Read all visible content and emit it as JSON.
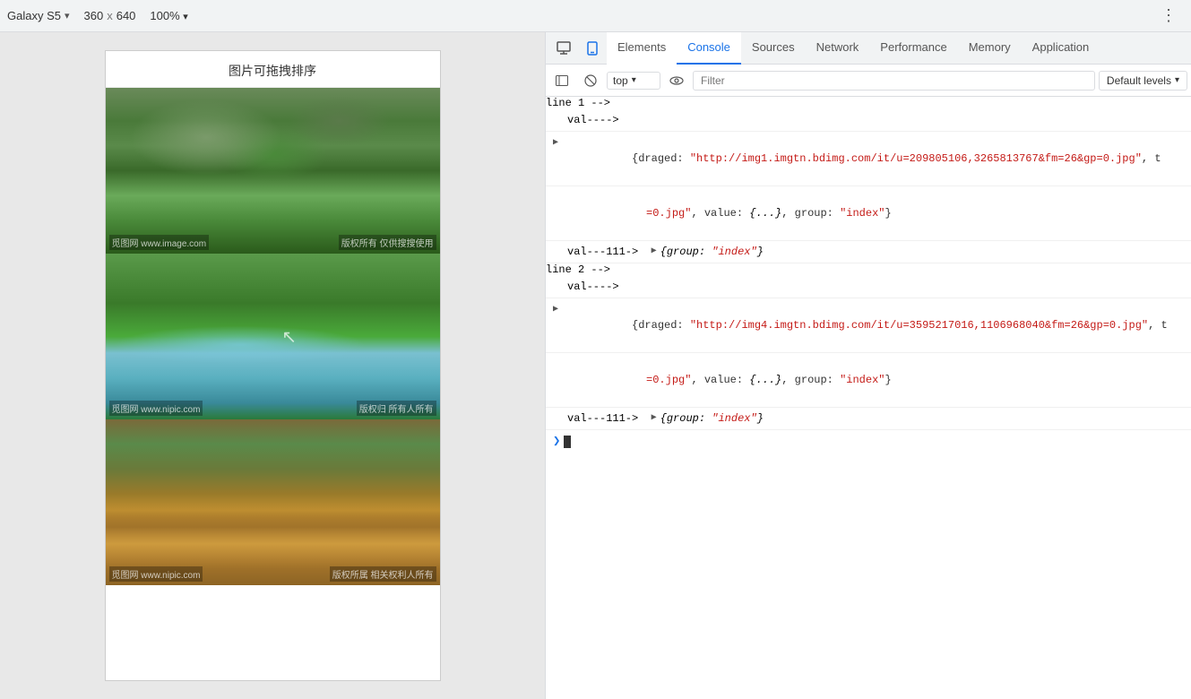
{
  "toolbar": {
    "device_name": "Galaxy S5",
    "chevron": "▾",
    "width": "360",
    "separator": "x",
    "height": "640",
    "zoom": "100%",
    "zoom_chevron": "▾",
    "more_icon": "⋮"
  },
  "viewport": {
    "page_title": "图片可拖拽排序",
    "images": [
      {
        "id": "img1",
        "watermark_left": "觅图网 www.image.com",
        "watermark_right": "版权所有 仅供搜搜使用"
      },
      {
        "id": "img2",
        "watermark_left": "觅图网 www.nipic.com",
        "watermark_right": "版权归 所有人所有"
      },
      {
        "id": "img3",
        "watermark_left": "觅图网 www.nipic.com",
        "watermark_right": "版权所属 相关权利人所有"
      }
    ]
  },
  "devtools": {
    "tabs": [
      {
        "id": "elements",
        "label": "Elements",
        "active": false
      },
      {
        "id": "console",
        "label": "Console",
        "active": true
      },
      {
        "id": "sources",
        "label": "Sources",
        "active": false
      },
      {
        "id": "network",
        "label": "Network",
        "active": false
      },
      {
        "id": "performance",
        "label": "Performance",
        "active": false
      },
      {
        "id": "memory",
        "label": "Memory",
        "active": false
      },
      {
        "id": "application",
        "label": "Application",
        "active": false
      }
    ],
    "console": {
      "context": "top",
      "context_chevron": "▾",
      "filter_placeholder": "Filter",
      "levels_label": "Default levels",
      "levels_chevron": "▾",
      "output": [
        {
          "type": "text",
          "content": "val---->",
          "indent": false,
          "expandable": false
        },
        {
          "type": "object",
          "expandable": true,
          "content": "{draged: \"http://img1.imgtn.bdimg.com/it/u=209805106,3265813767&fm=26&gp=0.jpg\", t=0.jpg\", value: {...}, group: \"index\"}"
        },
        {
          "type": "text",
          "content": "val---111-> ▶ {group: \"index\"}",
          "expandable": false
        },
        {
          "type": "text",
          "content": "val---->",
          "expandable": false
        },
        {
          "type": "object",
          "expandable": true,
          "content": "{draged: \"http://img4.imgtn.bdimg.com/it/u=3595217016,1106968040&fm=26&gp=0.jpg\", =0.jpg\", value: {...}, group: \"index\"}"
        },
        {
          "type": "text",
          "content": "val---111-> ▶ {group: \"index\"}",
          "expandable": false
        }
      ]
    }
  }
}
